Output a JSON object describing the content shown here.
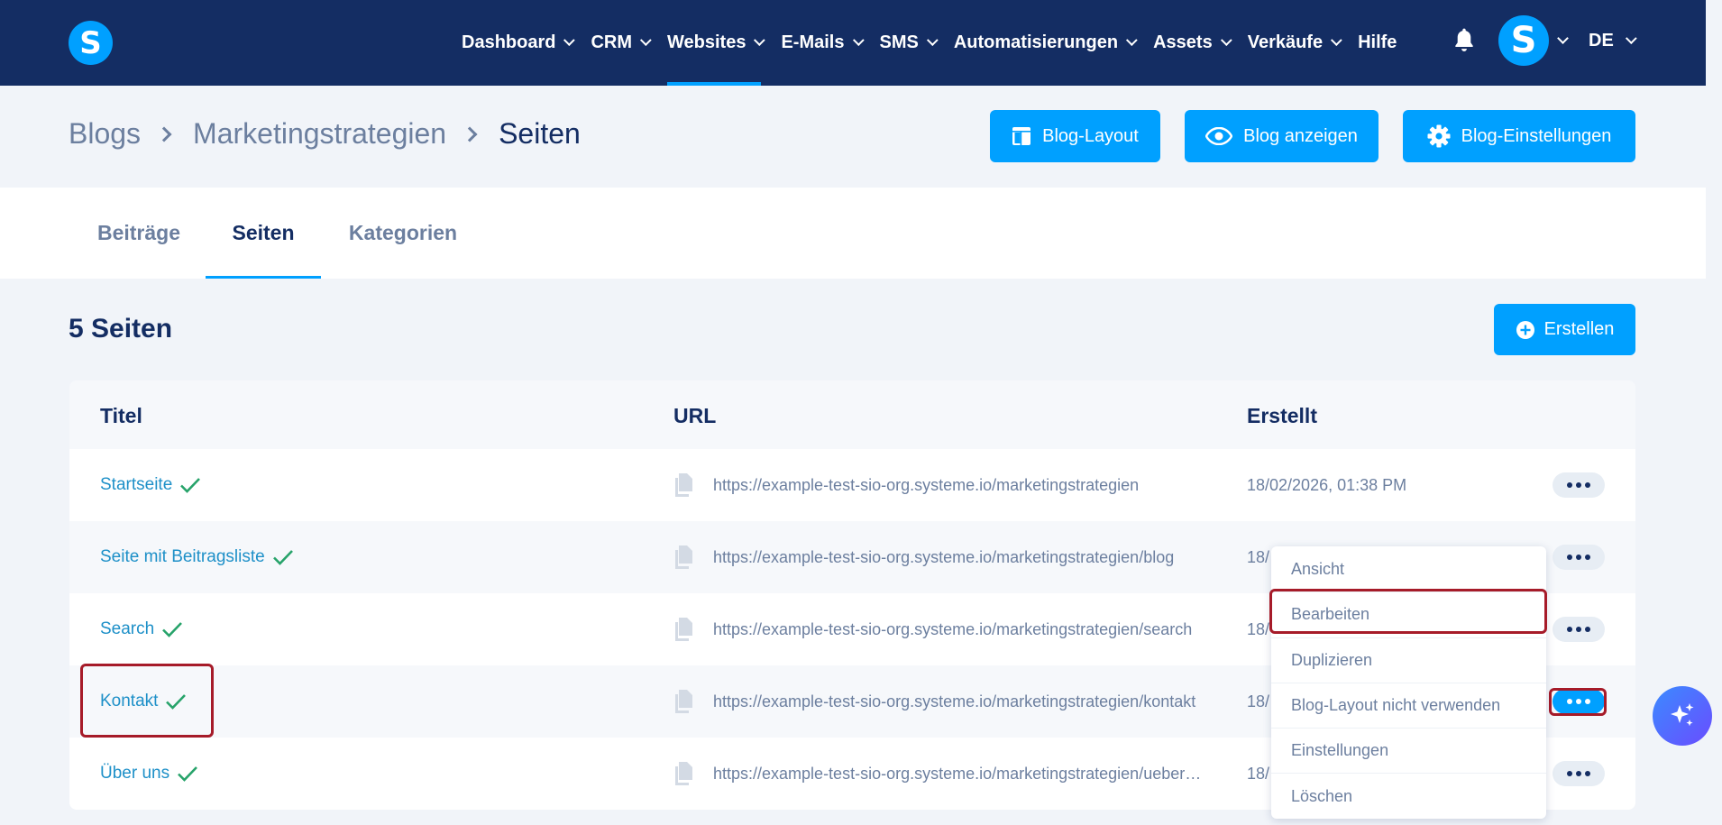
{
  "colors": {
    "navbar": "#142d63",
    "accent": "#00a0ff",
    "link": "#1e90c8",
    "highlight": "#a61b29",
    "check": "#27a36a"
  },
  "logo": {
    "letter": "S"
  },
  "nav": {
    "items": [
      {
        "label": "Dashboard"
      },
      {
        "label": "CRM"
      },
      {
        "label": "Websites"
      },
      {
        "label": "E-Mails"
      },
      {
        "label": "SMS"
      },
      {
        "label": "Automatisierungen"
      },
      {
        "label": "Assets"
      },
      {
        "label": "Verkäufe"
      },
      {
        "label": "Hilfe"
      }
    ],
    "active": "Websites",
    "avatar_letter": "S",
    "language": "DE"
  },
  "breadcrumb": {
    "items": [
      "Blogs",
      "Marketingstrategien",
      "Seiten"
    ]
  },
  "header_buttons": {
    "layout": "Blog-Layout",
    "view": "Blog anzeigen",
    "settings": "Blog-Einstellungen"
  },
  "tabs": {
    "items": [
      "Beiträge",
      "Seiten",
      "Kategorien"
    ],
    "active": "Seiten"
  },
  "section": {
    "title": "5 Seiten",
    "create_label": "Erstellen"
  },
  "table": {
    "headers": {
      "title": "Titel",
      "url": "URL",
      "created": "Erstellt"
    },
    "rows": [
      {
        "title": "Startseite",
        "url": "https://example-test-sio-org.systeme.io/marketingstrategien",
        "created": "18/02/2026, 01:38 PM"
      },
      {
        "title": "Seite mit Beitragsliste",
        "url": "https://example-test-sio-org.systeme.io/marketingstrategien/blog",
        "created": "18/"
      },
      {
        "title": "Search",
        "url": "https://example-test-sio-org.systeme.io/marketingstrategien/search",
        "created": "18/"
      },
      {
        "title": "Kontakt",
        "url": "https://example-test-sio-org.systeme.io/marketingstrategien/kontakt",
        "created": "18/"
      },
      {
        "title": "Über uns",
        "url": "https://example-test-sio-org.systeme.io/marketingstrategien/ueber-uns",
        "created": "18/"
      }
    ]
  },
  "dropdown": {
    "items": [
      "Ansicht",
      "Bearbeiten",
      "Duplizieren",
      "Blog-Layout nicht verwenden",
      "Einstellungen",
      "Löschen"
    ]
  }
}
